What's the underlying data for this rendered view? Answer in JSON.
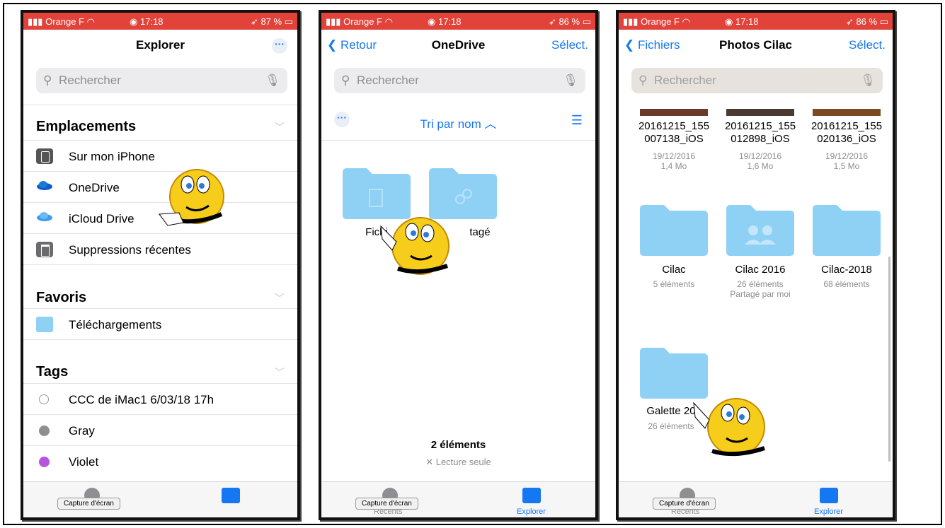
{
  "status": {
    "carrier": "Orange F",
    "time": "17:18",
    "battery_p1": "87 %",
    "battery_p2": "86 %",
    "battery_p3": "86 %"
  },
  "panel1": {
    "title": "Explorer",
    "search_placeholder": "Rechercher",
    "section_locations": "Emplacements",
    "locations": [
      "Sur mon iPhone",
      "OneDrive",
      "iCloud Drive",
      "Suppressions récentes"
    ],
    "section_favorites": "Favoris",
    "favorites": [
      "Téléchargements"
    ],
    "section_tags": "Tags",
    "tags": [
      {
        "label": "CCC de iMac1 6/03/18 17h",
        "color": "#ffffff"
      },
      {
        "label": "Gray",
        "color": "#8e8e93"
      },
      {
        "label": "Violet",
        "color": "#b455e0"
      }
    ],
    "capture_label": "Capture d'écran"
  },
  "panel2": {
    "back": "Retour",
    "title": "OneDrive",
    "select": "Sélect.",
    "search_placeholder": "Rechercher",
    "sort_label": "Tri par nom",
    "folders": [
      "Fichi",
      "tagé"
    ],
    "count": "2 éléments",
    "readonly": "Lecture seule",
    "capture_label": "Capture d'écran",
    "tab_recents": "Récents",
    "tab_explorer": "Explorer"
  },
  "panel3": {
    "back": "Fichiers",
    "title": "Photos Cilac",
    "select": "Sélect.",
    "search_placeholder": "Rechercher",
    "photos": [
      {
        "name1": "20161215_155",
        "name2": "007138_iOS",
        "date": "19/12/2016",
        "size": "1,4 Mo"
      },
      {
        "name1": "20161215_155",
        "name2": "012898_iOS",
        "date": "19/12/2016",
        "size": "1,6 Mo"
      },
      {
        "name1": "20161215_155",
        "name2": "020136_iOS",
        "date": "19/12/2016",
        "size": "1,5 Mo"
      }
    ],
    "folders": [
      {
        "name": "Cilac",
        "sub": "5 éléments",
        "sub2": ""
      },
      {
        "name": "Cilac 2016",
        "sub": "26 éléments",
        "sub2": "Partagé par moi"
      },
      {
        "name": "Cilac-2018",
        "sub": "68 éléments",
        "sub2": ""
      },
      {
        "name": "Galette 20",
        "sub": "26 éléments",
        "sub2": ""
      }
    ],
    "capture_label": "Capture d'écran",
    "tab_recents": "Récents",
    "tab_explorer": "Explorer"
  },
  "colors": {
    "accent": "#1677f2",
    "status_bar": "#e1433a",
    "folder": "#8fd0f5"
  }
}
